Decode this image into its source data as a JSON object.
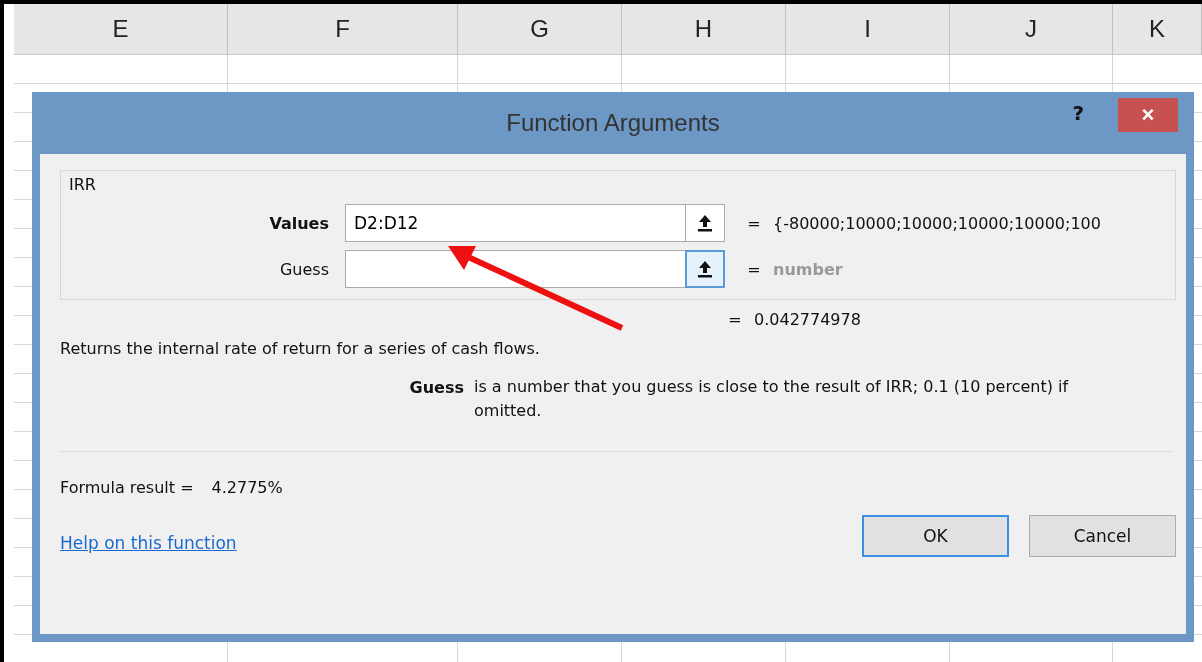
{
  "spreadsheet": {
    "columns": [
      "E",
      "F",
      "G",
      "H",
      "I",
      "J",
      "K"
    ]
  },
  "dialog": {
    "title": "Function Arguments",
    "help_button": "?",
    "close_button": "×",
    "function_name": "IRR",
    "arguments": [
      {
        "label": "Values",
        "required": true,
        "value": "D2:D12",
        "focused": false,
        "equals": "=",
        "result": "{-80000;10000;10000;10000;10000;100",
        "hint": false
      },
      {
        "label": "Guess",
        "required": false,
        "focused": true,
        "equals": "=",
        "result": "number",
        "hint": true
      }
    ],
    "formula_equals": "=",
    "formula_value": "0.042774978",
    "description": "Returns the internal rate of return for a series of cash flows.",
    "argument_help": {
      "name": "Guess",
      "text": "is a number that you guess is close to the result of IRR; 0.1 (10 percent) if omitted."
    },
    "formula_result_label": "Formula result =",
    "formula_result": "4.2775%",
    "help_link": "Help on this function",
    "buttons": [
      {
        "label": "OK",
        "default": true
      },
      {
        "label": "Cancel",
        "default": false
      }
    ]
  }
}
